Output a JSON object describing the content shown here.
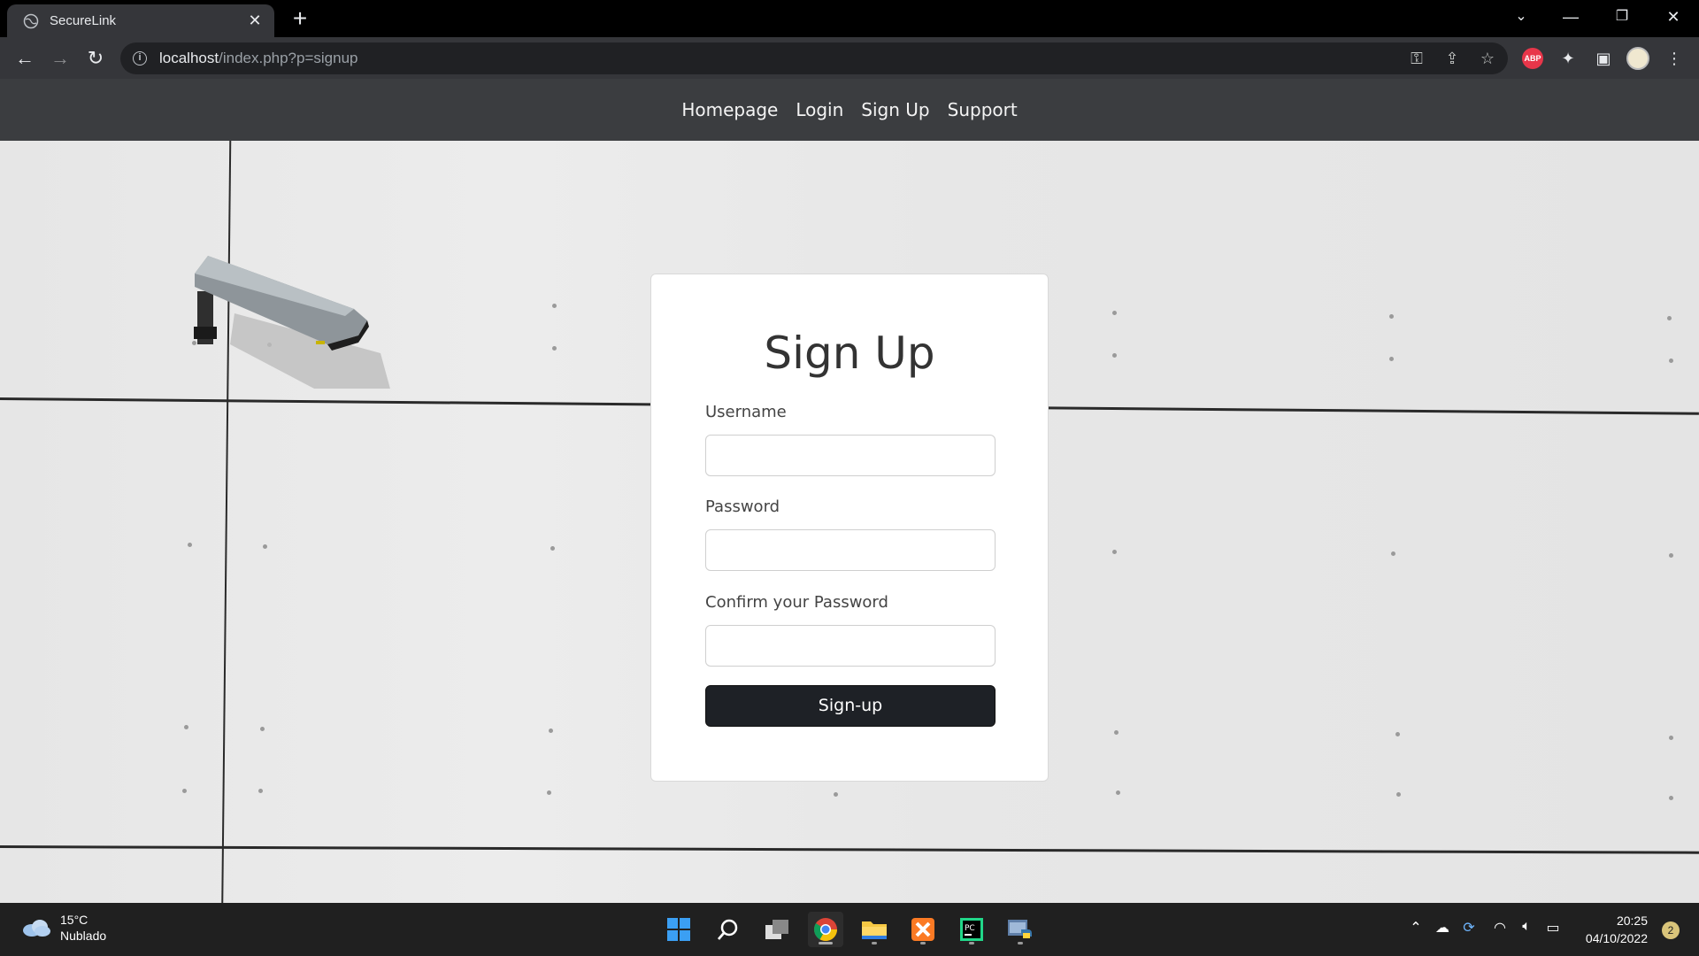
{
  "browser": {
    "tab_title": "SecureLink",
    "url_host": "localhost",
    "url_path": "/index.php?p=signup"
  },
  "site": {
    "nav": [
      "Homepage",
      "Login",
      "Sign Up",
      "Support"
    ]
  },
  "form": {
    "title": "Sign Up",
    "username_label": "Username",
    "username_value": "",
    "password_label": "Password",
    "password_value": "",
    "confirm_label": "Confirm your Password",
    "confirm_value": "",
    "submit_label": "Sign-up"
  },
  "taskbar": {
    "weather_temp": "15°C",
    "weather_desc": "Nublado",
    "time": "20:25",
    "date": "04/10/2022",
    "notifications": "2",
    "apps": [
      "start-icon",
      "search-icon",
      "task-view-icon",
      "chrome-icon",
      "file-explorer-icon",
      "xampp-icon",
      "pycharm-icon",
      "python-icon"
    ]
  },
  "colors": {
    "nav_bg": "#3b3d40",
    "button_bg": "#1e2126",
    "chrome_toolbar": "#35363a"
  }
}
